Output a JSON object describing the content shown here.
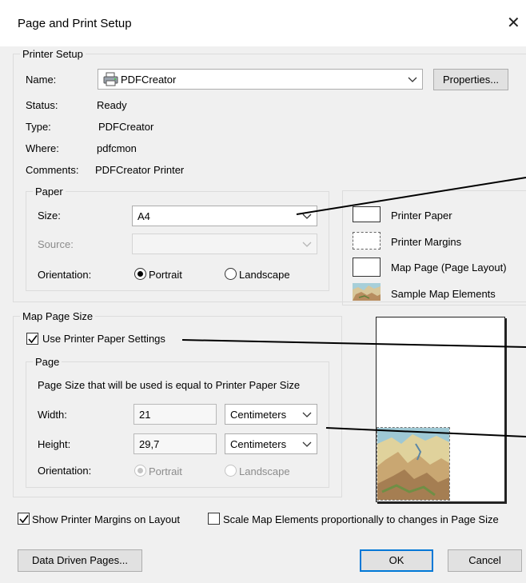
{
  "window": {
    "title": "Page and Print Setup",
    "close_glyph": "✕"
  },
  "printer_setup": {
    "legend": "Printer Setup",
    "name_label": "Name:",
    "name_value": "PDFCreator",
    "properties_button": "Properties...",
    "status_label": "Status:",
    "status_value": "Ready",
    "type_label": "Type:",
    "type_value": "PDFCreator",
    "where_label": "Where:",
    "where_value": "pdfcmon",
    "comments_label": "Comments:",
    "comments_value": "PDFCreator Printer",
    "paper": {
      "legend": "Paper",
      "size_label": "Size:",
      "size_value": "A4",
      "source_label": "Source:",
      "source_value": "",
      "orientation_label": "Orientation:",
      "portrait_label": "Portrait",
      "landscape_label": "Landscape",
      "portrait_checked": true
    }
  },
  "legend_box": {
    "printer_paper": "Printer Paper",
    "printer_margins": "Printer Margins",
    "map_page": "Map Page (Page Layout)",
    "sample_map": "Sample Map Elements"
  },
  "map_page_size": {
    "legend": "Map Page Size",
    "use_printer_paper_label": "Use Printer Paper Settings",
    "use_printer_paper_checked": true,
    "page": {
      "legend": "Page",
      "info_text": "Page Size that will be used is equal to Printer Paper Size",
      "width_label": "Width:",
      "width_value": "21",
      "width_unit": "Centimeters",
      "height_label": "Height:",
      "height_value": "29,7",
      "height_unit": "Centimeters",
      "orientation_label": "Orientation:",
      "portrait_label": "Portrait",
      "landscape_label": "Landscape"
    }
  },
  "bottom": {
    "show_margins_label": "Show Printer Margins on Layout",
    "show_margins_checked": true,
    "scale_elements_label": "Scale Map Elements proportionally to changes in Page Size",
    "scale_elements_checked": false,
    "data_driven_button": "Data Driven Pages...",
    "ok_button": "OK",
    "cancel_button": "Cancel"
  },
  "colors": {
    "accent": "#0078d7",
    "window_bg": "#f0f0f0"
  },
  "icons": {
    "printer": "printer-icon",
    "dropdown": "chevron-down-icon"
  }
}
